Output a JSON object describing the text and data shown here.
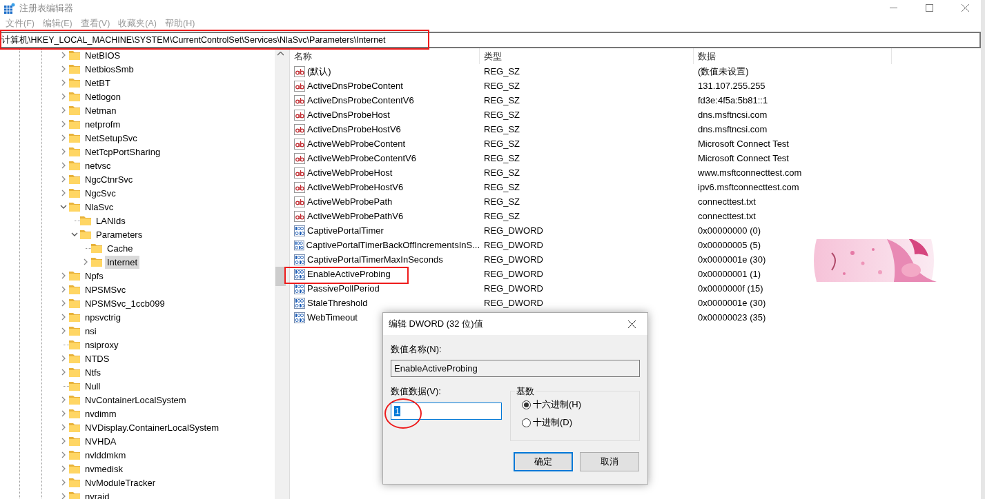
{
  "window": {
    "title": "注册表编辑器",
    "active": false
  },
  "menu": [
    "文件(F)",
    "编辑(E)",
    "查看(V)",
    "收藏夹(A)",
    "帮助(H)"
  ],
  "address": "计算机\\HKEY_LOCAL_MACHINE\\SYSTEM\\CurrentControlSet\\Services\\NlaSvc\\Parameters\\Internet",
  "tree": [
    {
      "label": "NetBIOS",
      "has_children": true,
      "expanded": false,
      "selected": false
    },
    {
      "label": "NetbiosSmb",
      "has_children": true,
      "expanded": false,
      "selected": false
    },
    {
      "label": "NetBT",
      "has_children": true,
      "expanded": false,
      "selected": false
    },
    {
      "label": "Netlogon",
      "has_children": true,
      "expanded": false,
      "selected": false
    },
    {
      "label": "Netman",
      "has_children": true,
      "expanded": false,
      "selected": false
    },
    {
      "label": "netprofm",
      "has_children": true,
      "expanded": false,
      "selected": false
    },
    {
      "label": "NetSetupSvc",
      "has_children": true,
      "expanded": false,
      "selected": false
    },
    {
      "label": "NetTcpPortSharing",
      "has_children": true,
      "expanded": false,
      "selected": false
    },
    {
      "label": "netvsc",
      "has_children": true,
      "expanded": false,
      "selected": false
    },
    {
      "label": "NgcCtnrSvc",
      "has_children": true,
      "expanded": false,
      "selected": false
    },
    {
      "label": "NgcSvc",
      "has_children": true,
      "expanded": false,
      "selected": false
    },
    {
      "label": "NlaSvc",
      "has_children": true,
      "expanded": true,
      "selected": false,
      "children": [
        {
          "label": "LANIds",
          "has_children": false,
          "selected": false
        },
        {
          "label": "Parameters",
          "has_children": true,
          "expanded": true,
          "selected": false,
          "children": [
            {
              "label": "Cache",
              "has_children": false,
              "selected": false
            },
            {
              "label": "Internet",
              "has_children": true,
              "expanded": false,
              "selected": true
            }
          ]
        }
      ]
    },
    {
      "label": "Npfs",
      "has_children": true,
      "expanded": false,
      "selected": false
    },
    {
      "label": "NPSMSvc",
      "has_children": true,
      "expanded": false,
      "selected": false
    },
    {
      "label": "NPSMSvc_1ccb099",
      "has_children": true,
      "expanded": false,
      "selected": false
    },
    {
      "label": "npsvctrig",
      "has_children": true,
      "expanded": false,
      "selected": false
    },
    {
      "label": "nsi",
      "has_children": true,
      "expanded": false,
      "selected": false
    },
    {
      "label": "nsiproxy",
      "has_children": false,
      "selected": false
    },
    {
      "label": "NTDS",
      "has_children": true,
      "expanded": false,
      "selected": false
    },
    {
      "label": "Ntfs",
      "has_children": true,
      "expanded": false,
      "selected": false
    },
    {
      "label": "Null",
      "has_children": false,
      "selected": false
    },
    {
      "label": "NvContainerLocalSystem",
      "has_children": true,
      "expanded": false,
      "selected": false
    },
    {
      "label": "nvdimm",
      "has_children": true,
      "expanded": false,
      "selected": false
    },
    {
      "label": "NVDisplay.ContainerLocalSystem",
      "has_children": true,
      "expanded": false,
      "selected": false
    },
    {
      "label": "NVHDA",
      "has_children": true,
      "expanded": false,
      "selected": false
    },
    {
      "label": "nvlddmkm",
      "has_children": true,
      "expanded": false,
      "selected": false
    },
    {
      "label": "nvmedisk",
      "has_children": true,
      "expanded": false,
      "selected": false
    },
    {
      "label": "NvModuleTracker",
      "has_children": true,
      "expanded": false,
      "selected": false
    },
    {
      "label": "nvraid",
      "has_children": true,
      "expanded": false,
      "selected": false
    }
  ],
  "table": {
    "columns": [
      "名称",
      "类型",
      "数据"
    ],
    "rows": [
      {
        "kind": "string",
        "name": "(默认)",
        "type": "REG_SZ",
        "data": "(数值未设置)"
      },
      {
        "kind": "string",
        "name": "ActiveDnsProbeContent",
        "type": "REG_SZ",
        "data": "131.107.255.255"
      },
      {
        "kind": "string",
        "name": "ActiveDnsProbeContentV6",
        "type": "REG_SZ",
        "data": "fd3e:4f5a:5b81::1"
      },
      {
        "kind": "string",
        "name": "ActiveDnsProbeHost",
        "type": "REG_SZ",
        "data": "dns.msftncsi.com"
      },
      {
        "kind": "string",
        "name": "ActiveDnsProbeHostV6",
        "type": "REG_SZ",
        "data": "dns.msftncsi.com"
      },
      {
        "kind": "string",
        "name": "ActiveWebProbeContent",
        "type": "REG_SZ",
        "data": "Microsoft Connect Test"
      },
      {
        "kind": "string",
        "name": "ActiveWebProbeContentV6",
        "type": "REG_SZ",
        "data": "Microsoft Connect Test"
      },
      {
        "kind": "string",
        "name": "ActiveWebProbeHost",
        "type": "REG_SZ",
        "data": "www.msftconnecttest.com"
      },
      {
        "kind": "string",
        "name": "ActiveWebProbeHostV6",
        "type": "REG_SZ",
        "data": "ipv6.msftconnecttest.com"
      },
      {
        "kind": "string",
        "name": "ActiveWebProbePath",
        "type": "REG_SZ",
        "data": "connecttest.txt"
      },
      {
        "kind": "string",
        "name": "ActiveWebProbePathV6",
        "type": "REG_SZ",
        "data": "connecttest.txt"
      },
      {
        "kind": "dword",
        "name": "CaptivePortalTimer",
        "type": "REG_DWORD",
        "data": "0x00000000 (0)"
      },
      {
        "kind": "dword",
        "name": "CaptivePortalTimerBackOffIncrementsInS...",
        "type": "REG_DWORD",
        "data": "0x00000005 (5)"
      },
      {
        "kind": "dword",
        "name": "CaptivePortalTimerMaxInSeconds",
        "type": "REG_DWORD",
        "data": "0x0000001e (30)"
      },
      {
        "kind": "dword",
        "name": "EnableActiveProbing",
        "type": "REG_DWORD",
        "data": "0x00000001 (1)"
      },
      {
        "kind": "dword",
        "name": "PassivePollPeriod",
        "type": "REG_DWORD",
        "data": "0x0000000f (15)"
      },
      {
        "kind": "dword",
        "name": "StaleThreshold",
        "type": "REG_DWORD",
        "data": "0x0000001e (30)"
      },
      {
        "kind": "dword",
        "name": "WebTimeout",
        "data": "0x00000023 (35)"
      }
    ]
  },
  "dialog": {
    "title": "编辑 DWORD (32 位)值",
    "name_label": "数值名称(N):",
    "name_value": "EnableActiveProbing",
    "data_label": "数值数据(V):",
    "data_value": "1",
    "data_value_selected": true,
    "base_label": "基数",
    "bases": [
      {
        "label": "十六进制(H)",
        "selected": true
      },
      {
        "label": "十进制(D)",
        "selected": false
      }
    ],
    "buttons": [
      {
        "label": "确定",
        "default": true
      },
      {
        "label": "取消",
        "default": false
      }
    ]
  },
  "annotations": [
    {
      "kind": "rect"
    },
    {
      "kind": "rect"
    },
    {
      "kind": "ellipse"
    }
  ]
}
